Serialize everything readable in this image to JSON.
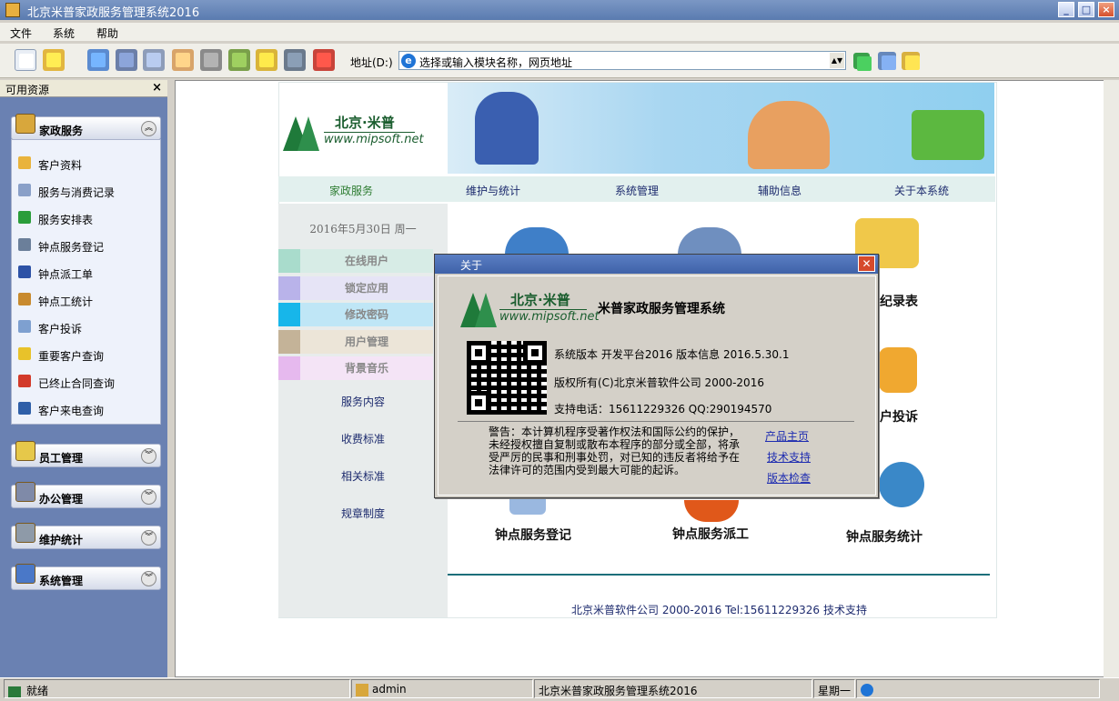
{
  "window": {
    "title": "北京米普家政服务管理系统2016"
  },
  "menu": {
    "items": [
      "文件",
      "系统",
      "帮助"
    ]
  },
  "address": {
    "label": "地址(D:)",
    "value": "选择或输入模块名称，网页地址"
  },
  "sidebar": {
    "header": "可用资源",
    "close": "×",
    "groups": [
      {
        "label": "家政服务",
        "expanded": true
      },
      {
        "label": "员工管理",
        "expanded": false
      },
      {
        "label": "办公管理",
        "expanded": false
      },
      {
        "label": "维护统计",
        "expanded": false
      },
      {
        "label": "系统管理",
        "expanded": false
      }
    ],
    "items": [
      "客户资料",
      "服务与消费记录",
      "服务安排表",
      "钟点服务登记",
      "钟点派工单",
      "钟点工统计",
      "客户投诉",
      "重要客户查询",
      "已终止合同查询",
      "客户来电查询"
    ],
    "item_colors": [
      "#e9b33c",
      "#8aa0c8",
      "#2a9d3a",
      "#6b7f9a",
      "#2d52a6",
      "#c88a2e",
      "#7ea0d0",
      "#e8c22a",
      "#d23a2a",
      "#2f5fa8"
    ]
  },
  "logo": {
    "cn": "北京·米普",
    "en": "www.mipsoft.net"
  },
  "nav": {
    "items": [
      "家政服务",
      "维护与统计",
      "系统管理",
      "辅助信息",
      "关于本系统"
    ]
  },
  "left": {
    "date": "2016年5月30日  周一",
    "buttons": [
      {
        "label": "在线用户",
        "color": "#a9dccc",
        "bg": "#d7ece6"
      },
      {
        "label": "锁定应用",
        "color": "#b9b3ea",
        "bg": "#e6e4f6"
      },
      {
        "label": "修改密码",
        "color": "#17b6ea",
        "bg": "#bfe6f6"
      },
      {
        "label": "用户管理",
        "color": "#c4b398",
        "bg": "#ece5d8"
      },
      {
        "label": "背景音乐",
        "color": "#e6b9ee",
        "bg": "#f4e4f6"
      }
    ],
    "links": [
      "服务内容",
      "收费标准",
      "相关标准",
      "规章制度"
    ]
  },
  "main": {
    "labels": [
      "纪录表",
      "户投诉",
      "钟点服务登记",
      "钟点服务派工",
      "钟点服务统计"
    ],
    "footer": "北京米普软件公司 2000-2016  Tel:15611229326",
    "footer_link": "技术支持"
  },
  "dialog": {
    "title": "关于",
    "close": "✕",
    "app_name": "米普家政服务管理系统",
    "version": "系统版本  开发平台2016  版本信息  2016.5.30.1",
    "copyright": "版权所有(C)北京米普软件公司   2000-2016",
    "support": "支持电话：15611229326    QQ:290194570",
    "warning": "警告：本计算机程序受著作权法和国际公约的保护，未经授权擅自复制或散布本程序的部分或全部，将承受严厉的民事和刑事处罚，对已知的违反者将给予在法律许可的范围内受到最大可能的起诉。",
    "links": [
      "产品主页",
      "技术支持",
      "版本检查"
    ]
  },
  "status": {
    "ready": "就绪",
    "user": "admin",
    "app": "北京米普家政服务管理系统2016",
    "day": "星期一"
  }
}
